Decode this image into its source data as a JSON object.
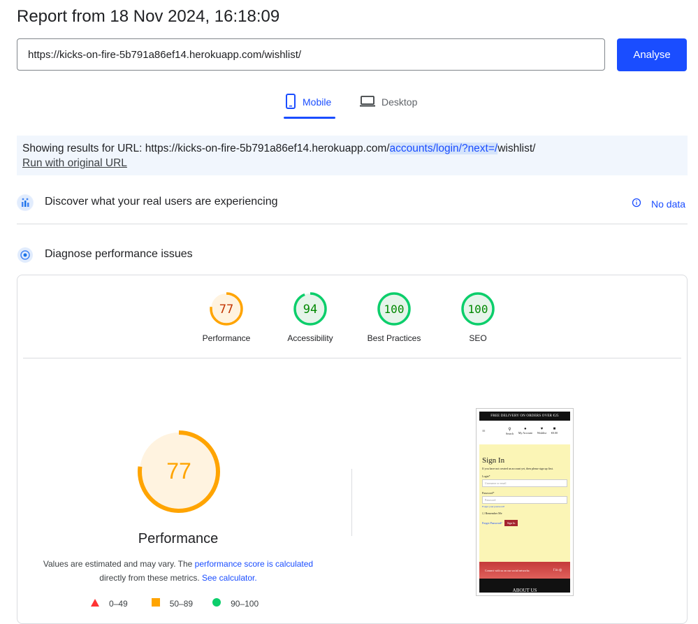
{
  "header": {
    "title": "Report from 18 Nov 2024, 16:18:09",
    "url_value": "https://kicks-on-fire-5b791a86ef14.herokuapp.com/wishlist/",
    "analyse_label": "Analyse"
  },
  "tabs": [
    {
      "label": "Mobile",
      "active": true
    },
    {
      "label": "Desktop",
      "active": false
    }
  ],
  "banner": {
    "prefix": "Showing results for URL: https://kicks-on-fire-5b791a86ef14.herokuapp.com/",
    "highlight": "accounts/login/?next=/",
    "suffix": "wishlist/",
    "run_original": "Run with original URL"
  },
  "field_data": {
    "title": "Discover what your real users are experiencing",
    "no_data": "No data"
  },
  "diagnose": {
    "title": "Diagnose performance issues"
  },
  "scores": [
    {
      "label": "Performance",
      "score": "77",
      "value": 0.77,
      "color": "#ffa400",
      "text_color": "#c33300",
      "bg": "#fff3e0"
    },
    {
      "label": "Accessibility",
      "score": "94",
      "value": 0.94,
      "color": "#0cce6b",
      "text_color": "#008800",
      "bg": "#e6f4ea"
    },
    {
      "label": "Best Practices",
      "score": "100",
      "value": 1.0,
      "color": "#0cce6b",
      "text_color": "#008800",
      "bg": "#e6f4ea"
    },
    {
      "label": "SEO",
      "score": "100",
      "value": 1.0,
      "color": "#0cce6b",
      "text_color": "#008800",
      "bg": "#e6f4ea"
    }
  ],
  "performance": {
    "score": "77",
    "value": 0.77,
    "title": "Performance",
    "desc_1": "Values are estimated and may vary. The ",
    "desc_link1": "performance score is calculated",
    "desc_2": " directly from these metrics. ",
    "desc_link2": "See calculator.",
    "legend": [
      {
        "range": "0–49",
        "shape": "triangle",
        "color": "#ff3333"
      },
      {
        "range": "50–89",
        "shape": "square",
        "color": "#ffa400"
      },
      {
        "range": "90–100",
        "shape": "circle",
        "color": "#0cce6b"
      }
    ]
  },
  "phone": {
    "banner": "FREE DELIVERY ON ORDERS OVER €25",
    "nav": [
      "Search",
      "My Account",
      "Wishlist",
      "€0.00"
    ],
    "title": "Sign In",
    "intro": "If you have not created an account yet, then please sign up first.",
    "login_label": "Login*",
    "login_placeholder": "Username or email",
    "password_label": "Password*",
    "password_placeholder": "Password",
    "forgot_small": "Forgot your password?",
    "remember": "Remember Me",
    "forgot": "Forgot Password?",
    "signin": "Sign In",
    "footer": "Connect with us on our social networks:",
    "about": "ABOUT US"
  }
}
